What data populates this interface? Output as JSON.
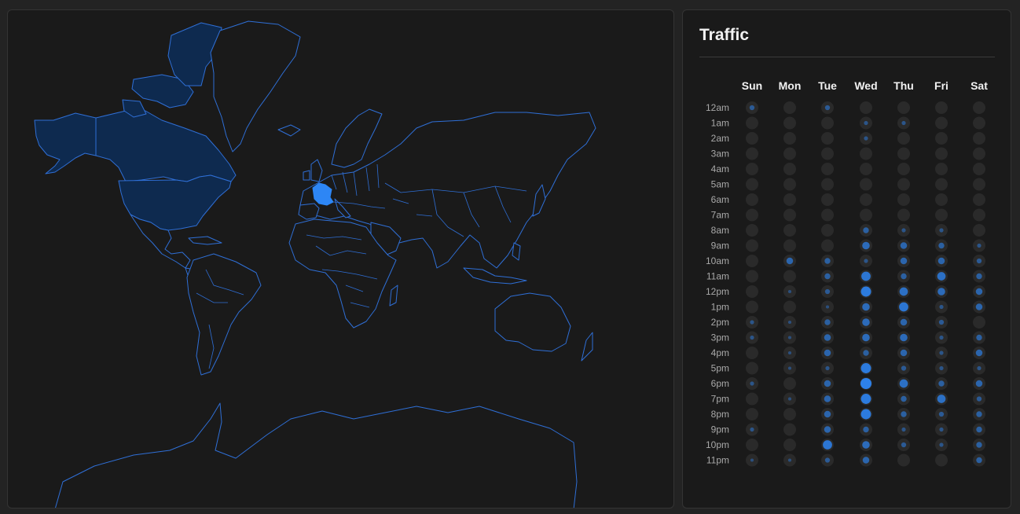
{
  "traffic": {
    "title": "Traffic",
    "accent_color": "#2d86f5",
    "days": [
      "Sun",
      "Mon",
      "Tue",
      "Wed",
      "Thu",
      "Fri",
      "Sat"
    ],
    "hours": [
      "12am",
      "1am",
      "2am",
      "3am",
      "4am",
      "5am",
      "6am",
      "7am",
      "8am",
      "9am",
      "10am",
      "11am",
      "12pm",
      "1pm",
      "2pm",
      "3pm",
      "4pm",
      "5pm",
      "6pm",
      "7pm",
      "8pm",
      "9pm",
      "10pm",
      "11pm"
    ],
    "chart_data": {
      "type": "heatmap",
      "x": [
        "Sun",
        "Mon",
        "Tue",
        "Wed",
        "Thu",
        "Fri",
        "Sat"
      ],
      "y": [
        "12am",
        "1am",
        "2am",
        "3am",
        "4am",
        "5am",
        "6am",
        "7am",
        "8am",
        "9am",
        "10am",
        "11am",
        "12pm",
        "1pm",
        "2pm",
        "3pm",
        "4pm",
        "5pm",
        "6pm",
        "7pm",
        "8pm",
        "9pm",
        "10pm",
        "11pm"
      ],
      "values": [
        [
          0.3,
          0,
          0.3,
          0,
          0,
          0,
          0
        ],
        [
          0,
          0,
          0,
          0.2,
          0.2,
          0,
          0
        ],
        [
          0,
          0,
          0,
          0.2,
          0,
          0,
          0
        ],
        [
          0,
          0,
          0,
          0,
          0,
          0,
          0
        ],
        [
          0,
          0,
          0,
          0,
          0,
          0,
          0
        ],
        [
          0,
          0,
          0,
          0,
          0,
          0,
          0
        ],
        [
          0,
          0,
          0,
          0,
          0,
          0,
          0
        ],
        [
          0,
          0,
          0,
          0,
          0,
          0,
          0
        ],
        [
          0,
          0,
          0,
          0.4,
          0.2,
          0.2,
          0
        ],
        [
          0,
          0,
          0,
          0.6,
          0.5,
          0.4,
          0.2
        ],
        [
          0,
          0.5,
          0.4,
          0.2,
          0.5,
          0.5,
          0.3
        ],
        [
          0,
          0,
          0.4,
          0.8,
          0.4,
          0.7,
          0.4
        ],
        [
          0,
          0.1,
          0.3,
          0.9,
          0.7,
          0.6,
          0.5
        ],
        [
          0,
          0,
          0.1,
          0.6,
          0.8,
          0.2,
          0.5
        ],
        [
          0.2,
          0.1,
          0.4,
          0.6,
          0.5,
          0.3,
          0
        ],
        [
          0.2,
          0.1,
          0.5,
          0.6,
          0.6,
          0.2,
          0.4
        ],
        [
          0,
          0.1,
          0.5,
          0.4,
          0.5,
          0.2,
          0.5
        ],
        [
          0,
          0.1,
          0.2,
          0.9,
          0.3,
          0.2,
          0.2
        ],
        [
          0.2,
          0,
          0.5,
          1.0,
          0.7,
          0.4,
          0.5
        ],
        [
          0,
          0.1,
          0.5,
          0.9,
          0.4,
          0.7,
          0.3
        ],
        [
          0,
          0,
          0.5,
          0.9,
          0.4,
          0.3,
          0.4
        ],
        [
          0.2,
          0,
          0.5,
          0.4,
          0.2,
          0.2,
          0.4
        ],
        [
          0,
          0,
          0.8,
          0.6,
          0.3,
          0.2,
          0.4
        ],
        [
          0.1,
          0.1,
          0.3,
          0.5,
          0,
          0,
          0.4
        ]
      ]
    }
  },
  "map": {
    "highlight_color": "#2d86f5",
    "dim_highlight_color": "#0e2a4f",
    "stroke_color": "#2f6fd6",
    "highlighted_countries": [
      "United States",
      "Canada",
      "France"
    ]
  }
}
